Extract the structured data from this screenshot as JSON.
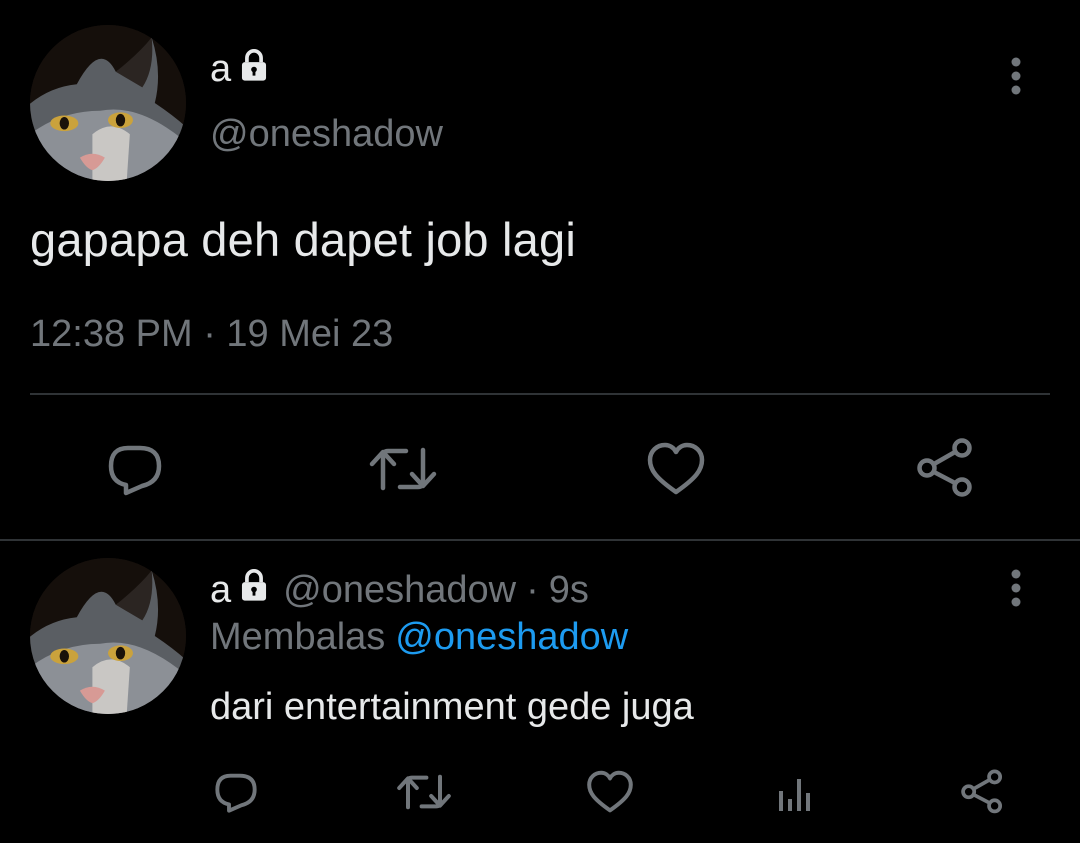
{
  "main_tweet": {
    "display_name": "a",
    "handle": "@oneshadow",
    "text": "gapapa deh dapet job lagi",
    "timestamp": "12:38 PM · 19 Mei 23",
    "protected_icon": "lock-icon",
    "actions": [
      "reply-icon",
      "retweet-icon",
      "like-icon",
      "share-icon"
    ]
  },
  "reply_tweet": {
    "display_name": "a",
    "handle": "@oneshadow",
    "separator": "·",
    "time": "9s",
    "replying_label": "Membalas",
    "replying_to": "@oneshadow",
    "text": "dari entertainment gede juga",
    "protected_icon": "lock-icon",
    "actions": [
      "reply-icon",
      "retweet-icon",
      "like-icon",
      "views-icon",
      "share-icon"
    ]
  },
  "colors": {
    "background": "#000000",
    "primary_text": "#e7e9ea",
    "secondary_text": "#71767b",
    "accent": "#1d9bf0",
    "divider": "#2f3336"
  }
}
